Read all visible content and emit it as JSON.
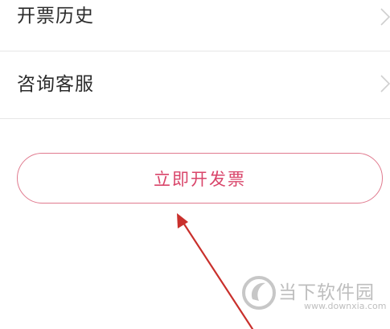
{
  "menu": {
    "items": [
      {
        "label": "开票历史"
      },
      {
        "label": "咨询客服"
      }
    ]
  },
  "actions": {
    "issue_invoice_label": "立即开发票"
  },
  "watermark": {
    "name": "当下软件园",
    "url": "www.downxia.com"
  },
  "colors": {
    "accent": "#d9456a",
    "button_border": "#e07a8e",
    "arrow": "#c9302c",
    "divider": "#e6e6e6"
  },
  "icons": {
    "row_chevron": "chevron-right-icon",
    "annotation": "red-arrow-annotation",
    "watermark_logo": "downxia-logo"
  }
}
